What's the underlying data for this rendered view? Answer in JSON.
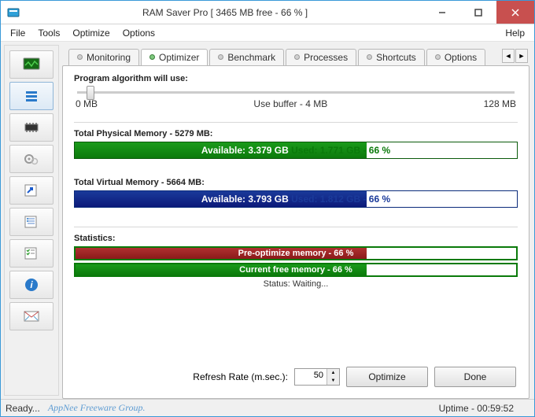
{
  "title": "RAM Saver Pro [ 3465 MB free - 66 % ]",
  "menu": {
    "file": "File",
    "tools": "Tools",
    "optimize": "Optimize",
    "options": "Options",
    "help": "Help"
  },
  "tabs": {
    "monitoring": "Monitoring",
    "optimizer": "Optimizer",
    "benchmark": "Benchmark",
    "processes": "Processes",
    "shortcuts": "Shortcuts",
    "options": "Options"
  },
  "algorithm": {
    "label": "Program algorithm will use:",
    "min": "0 MB",
    "mid": "Use buffer - 4 MB",
    "max": "128 MB"
  },
  "physical": {
    "label": "Total Physical Memory - 5279 MB:",
    "percent": 66,
    "avail_prefix": "Available: ",
    "avail_value": "3.379 GB",
    "used_prefix": "  Used: ",
    "used_value": "1.771 GB - 66 %"
  },
  "virtual": {
    "label": "Total Virtual Memory - 5664 MB:",
    "percent": 66,
    "avail_prefix": "Available: ",
    "avail_value": "3.793 GB",
    "used_prefix": "  Used: ",
    "used_value": "1.812 GB - 66 %"
  },
  "stats": {
    "label": "Statistics:",
    "pre_label": "Pre-optimize memory - 66 %",
    "pre_percent": 66,
    "cur_label": "Current free memory - 66 %",
    "cur_percent": 66,
    "status": "Status: Waiting..."
  },
  "bottom": {
    "refresh_label": "Refresh Rate (m.sec.):",
    "refresh_value": "50",
    "optimize": "Optimize",
    "done": "Done"
  },
  "statusbar": {
    "ready": "Ready...",
    "watermark": "AppNee Freeware Group.",
    "uptime": "Uptime - 00:59:52"
  }
}
